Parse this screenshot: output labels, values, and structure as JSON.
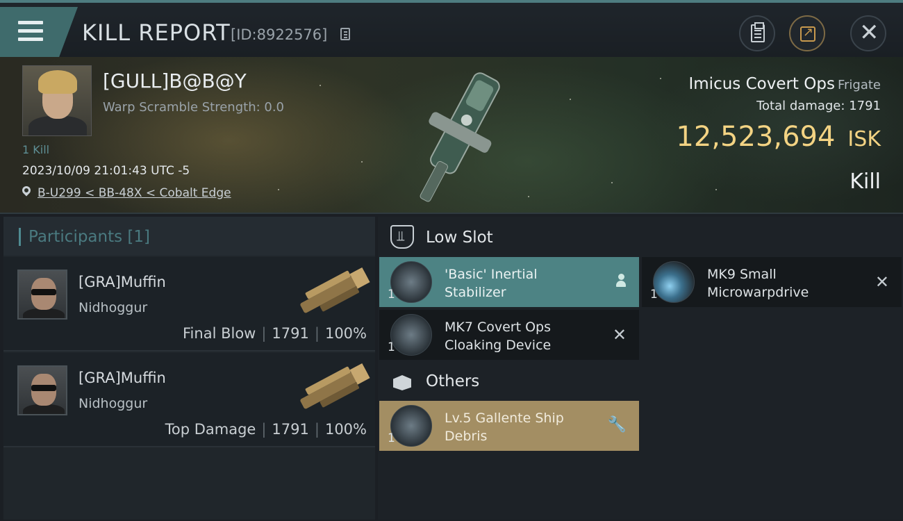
{
  "header": {
    "title": "KILL REPORT",
    "report_id": "[ID:8922576]"
  },
  "victim": {
    "name": "[GULL]B@B@Y",
    "warp_scramble": "Warp Scramble Strength: 0.0",
    "kills": "1 Kill",
    "timestamp": "2023/10/09 21:01:43 UTC -5",
    "location": "B-U299 < BB-48X < Cobalt Edge"
  },
  "ship": {
    "name": "Imicus Covert Ops",
    "class": "Frigate",
    "total_damage_label": "Total damage:",
    "total_damage": "1791",
    "isk_value": "12,523,694",
    "isk_unit": "ISK",
    "result": "Kill"
  },
  "participants": {
    "header": "Participants [1]",
    "rows": [
      {
        "name": "[GRA]Muffin",
        "ship": "Nidhoggur",
        "role": "Final Blow",
        "damage": "1791",
        "percent": "100%"
      },
      {
        "name": "[GRA]Muffin",
        "ship": "Nidhoggur",
        "role": "Top Damage",
        "damage": "1791",
        "percent": "100%"
      }
    ]
  },
  "low_slot": {
    "title": "Low Slot",
    "modules": [
      {
        "name_line1": "'Basic' Inertial",
        "name_line2": "Stabilizer",
        "qty": "1",
        "status": "dropped"
      },
      {
        "name_line1": "MK9 Small",
        "name_line2": "Microwarpdrive",
        "qty": "1",
        "status": "destroyed"
      },
      {
        "name_line1": "MK7 Covert Ops",
        "name_line2": "Cloaking Device",
        "qty": "1",
        "status": "destroyed"
      }
    ]
  },
  "others": {
    "title": "Others",
    "modules": [
      {
        "name_line1": "Lv.5 Gallente Ship",
        "name_line2": "Debris",
        "qty": "1",
        "status": "salvage"
      }
    ]
  },
  "colors": {
    "accent_teal": "#4d8384",
    "isk_gold": "#f3d383",
    "salvage_gold": "#a38e63"
  }
}
